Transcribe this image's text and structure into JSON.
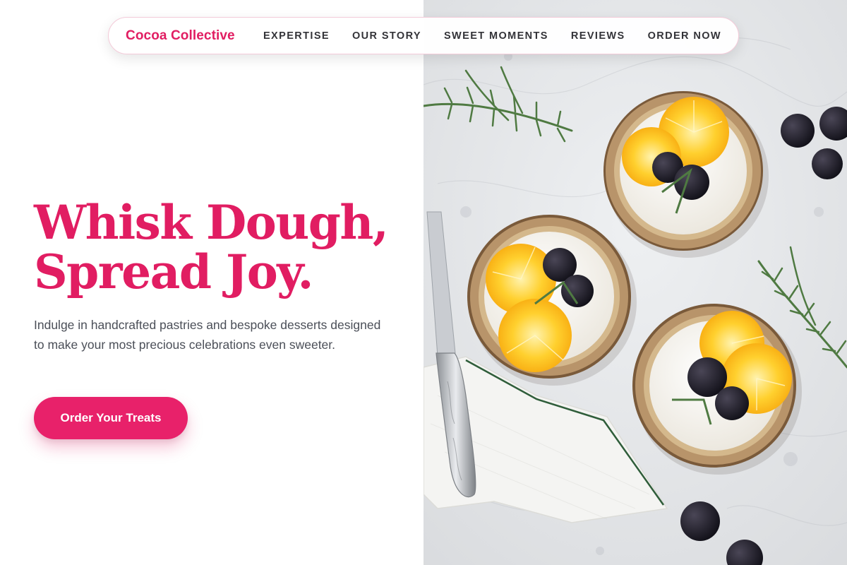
{
  "brand": {
    "name": "Cocoa Collective"
  },
  "nav": {
    "links": [
      {
        "label": "EXPERTISE"
      },
      {
        "label": "OUR STORY"
      },
      {
        "label": "SWEET MOMENTS"
      },
      {
        "label": "REVIEWS"
      },
      {
        "label": "ORDER NOW"
      }
    ]
  },
  "hero": {
    "title_line1": "Whisk Dough,",
    "title_line2": "Spread Joy.",
    "subtitle": "Indulge in handcrafted pastries and bespoke desserts designed to make your most precious celebrations even sweeter.",
    "cta_label": "Order Your Treats",
    "image_subject": "tartlets-with-oranges-and-blackberries-photo"
  },
  "colors": {
    "accent": "#e11d62",
    "button": "#e8216a",
    "text_body": "#4b4f58",
    "nav_text": "#333338"
  }
}
